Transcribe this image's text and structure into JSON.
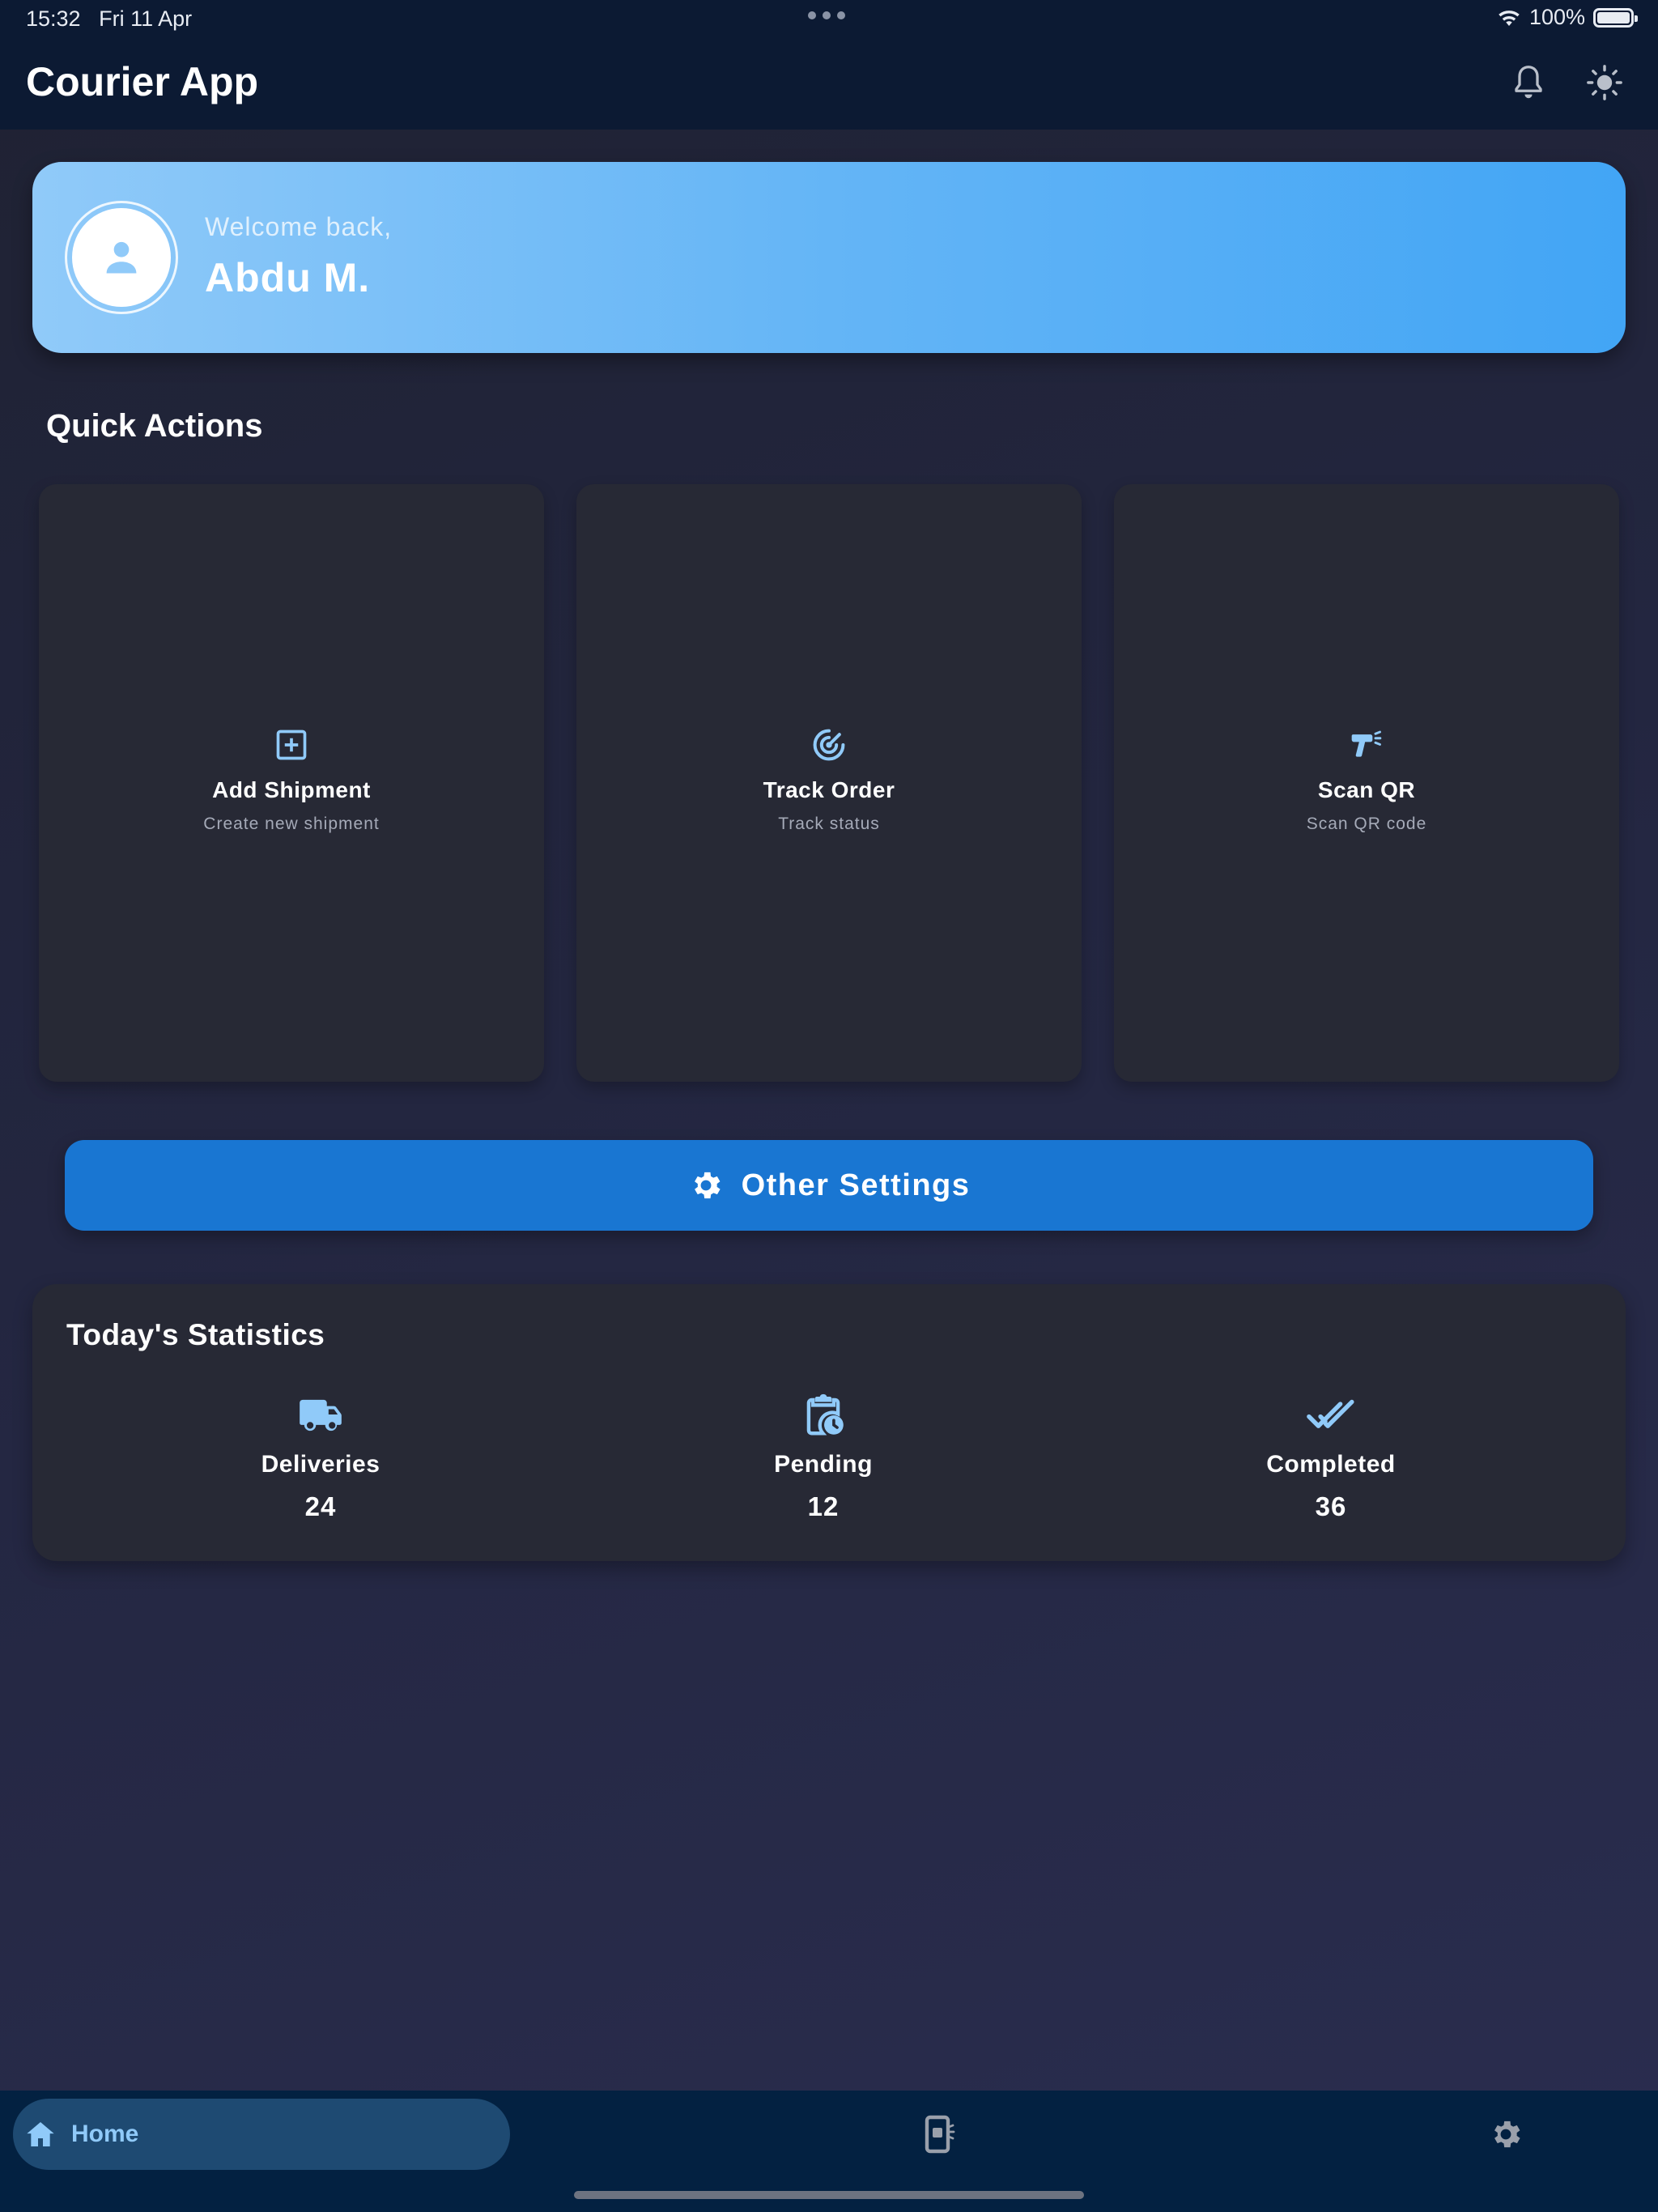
{
  "status_bar": {
    "time": "15:32",
    "date": "Fri 11 Apr",
    "battery": "100%"
  },
  "header": {
    "title": "Courier App",
    "icons": [
      "bell-icon",
      "brightness-icon"
    ]
  },
  "welcome": {
    "greeting": "Welcome back,",
    "name": "Abdu M."
  },
  "quick_actions": {
    "title": "Quick Actions",
    "items": [
      {
        "label": "Add Shipment",
        "description": "Create new shipment",
        "icon": "add-box-icon"
      },
      {
        "label": "Track Order",
        "description": "Track status",
        "icon": "radar-icon"
      },
      {
        "label": "Scan QR",
        "description": "Scan QR code",
        "icon": "barcode-scanner-icon"
      }
    ]
  },
  "settings_button": {
    "label": "Other Settings",
    "icon": "gear-icon"
  },
  "statistics": {
    "title": "Today's Statistics",
    "items": [
      {
        "label": "Deliveries",
        "value": "24",
        "icon": "truck-icon"
      },
      {
        "label": "Pending",
        "value": "12",
        "icon": "clipboard-clock-icon"
      },
      {
        "label": "Completed",
        "value": "36",
        "icon": "double-check-icon"
      }
    ]
  },
  "bottom_nav": {
    "items": [
      {
        "label": "Home",
        "icon": "home-icon",
        "active": true
      },
      {
        "label": "",
        "icon": "device-settings-icon",
        "active": false
      },
      {
        "label": "",
        "icon": "gear-icon",
        "active": false
      }
    ]
  },
  "colors": {
    "accent": "#42a5f5",
    "icon_blue": "#90caf9",
    "button_blue": "#1976d2",
    "card_bg": "#272935",
    "top_bar": "#0c1a33",
    "nav_bar": "#032141"
  }
}
